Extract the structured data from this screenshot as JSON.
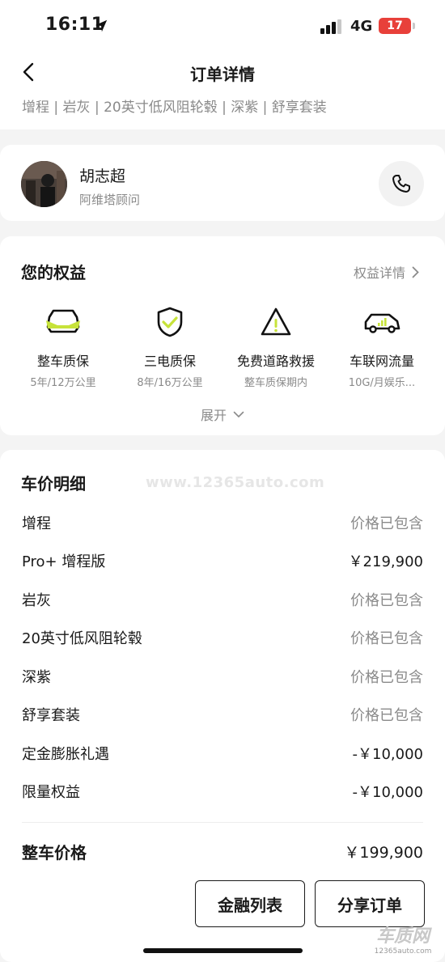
{
  "status_bar": {
    "time": "16:11",
    "network": "4G",
    "battery": "17"
  },
  "header": {
    "title": "订单详情",
    "config": "增程 | 岩灰 | 20英寸低风阻轮毂 | 深紫 | 舒享套装"
  },
  "advisor": {
    "name": "胡志超",
    "role": "阿维塔顾问"
  },
  "benefits": {
    "title": "您的权益",
    "detail_link": "权益详情",
    "items": [
      {
        "label": "整车质保",
        "sub": "5年/12万公里",
        "icon": "car-shield-icon"
      },
      {
        "label": "三电质保",
        "sub": "8年/16万公里",
        "icon": "shield-check-icon"
      },
      {
        "label": "免费道路救援",
        "sub": "整车质保期内",
        "icon": "warning-triangle-icon"
      },
      {
        "label": "车联网流量",
        "sub": "10G/月娱乐...",
        "icon": "connected-car-icon"
      }
    ],
    "expand_label": "展开",
    "accent": "#c7e33a"
  },
  "price": {
    "title": "车价明细",
    "watermark": "www.12365auto.com",
    "rows": [
      {
        "label": "增程",
        "value": "价格已包含"
      },
      {
        "label": "Pro+ 增程版",
        "value": "￥219,900"
      },
      {
        "label": "岩灰",
        "value": "价格已包含"
      },
      {
        "label": "20英寸低风阻轮毂",
        "value": "价格已包含"
      },
      {
        "label": "深紫",
        "value": "价格已包含"
      },
      {
        "label": "舒享套装",
        "value": "价格已包含"
      },
      {
        "label": "定金膨胀礼遇",
        "value": "-￥10,000"
      },
      {
        "label": "限量权益",
        "value": "-￥10,000"
      }
    ],
    "total_label": "整车价格",
    "total_value": "￥199,900"
  },
  "actions": {
    "finance": "金融列表",
    "share": "分享订单"
  },
  "corner_logo": {
    "main": "车质网",
    "sub": "12365auto.com"
  }
}
